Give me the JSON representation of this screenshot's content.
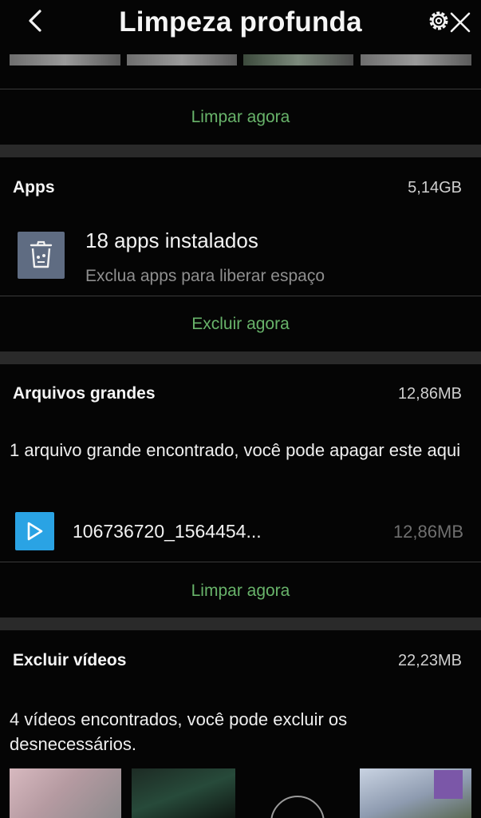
{
  "header": {
    "title": "Limpeza profunda",
    "icons": {
      "back": "chevron-left-icon",
      "settings": "gear-icon",
      "close": "close-icon"
    }
  },
  "photos_section": {
    "action_label": "Limpar agora"
  },
  "apps_section": {
    "title": "Apps",
    "size": "5,14GB",
    "item_title": "18 apps instalados",
    "item_subtitle": "Exclua apps para liberar espaço",
    "icon": "trash-bin-icon",
    "action_label": "Excluir agora"
  },
  "large_files_section": {
    "title": "Arquivos grandes",
    "size": "12,86MB",
    "description": "1 arquivo grande encontrado, você pode apagar este aqui",
    "file": {
      "name": "106736720_1564454...",
      "size": "12,86MB",
      "icon": "video-play-icon"
    },
    "action_label": "Limpar agora"
  },
  "videos_section": {
    "title": "Excluir vídeos",
    "size": "22,23MB",
    "description": "4 vídeos encontrados, você pode excluir os desnecessários."
  },
  "colors": {
    "background": "#050505",
    "separator": "#2a2a2a",
    "accent_green": "#68b36a",
    "app_icon_bg": "#5f6c82",
    "file_icon_bg": "#2aa3e4"
  }
}
